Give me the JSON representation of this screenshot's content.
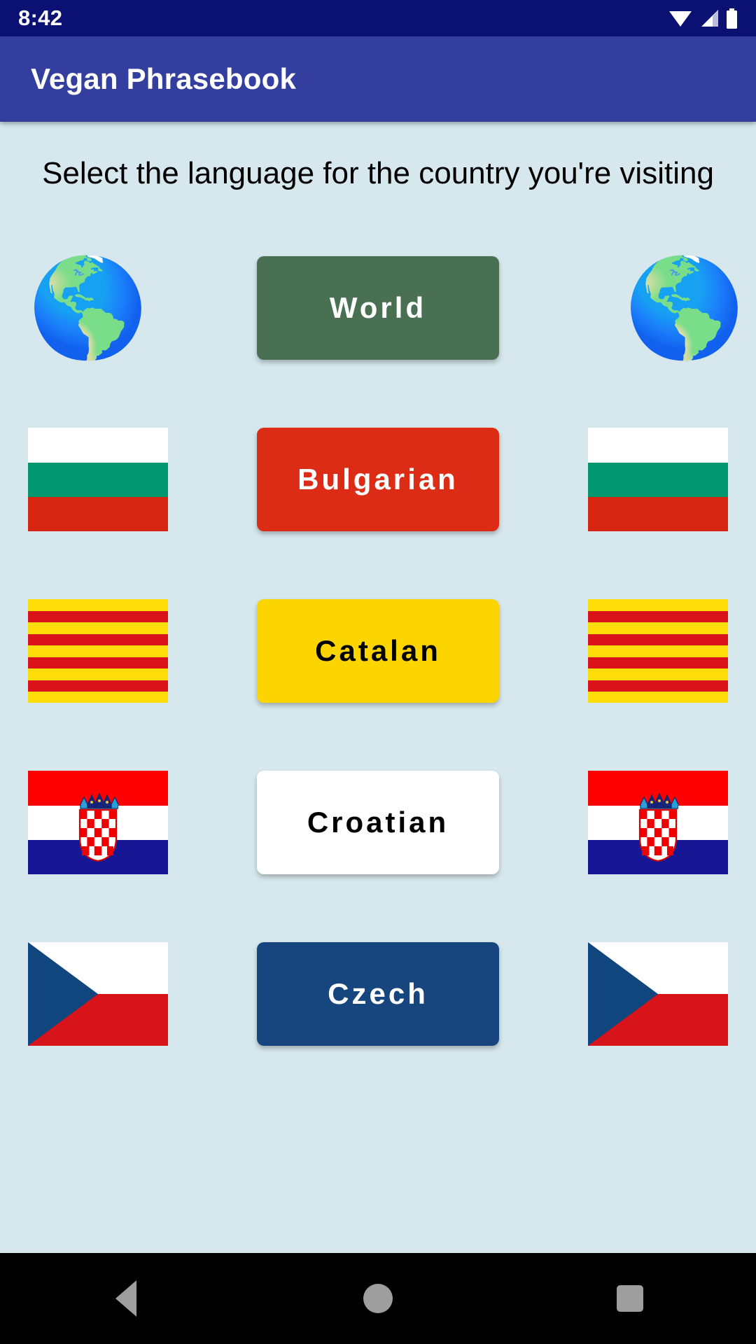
{
  "status_bar": {
    "time": "8:42",
    "icons": [
      "wifi-icon",
      "signal-icon",
      "battery-icon"
    ],
    "background": "#0a1172"
  },
  "app_bar": {
    "title": "Vegan Phrasebook",
    "background": "#333e9e",
    "text_color": "#ffffff"
  },
  "page": {
    "background": "#d6e8ed",
    "prompt": "Select the language for the country you're visiting"
  },
  "languages": [
    {
      "label": "World",
      "icon": "globe-icon",
      "icon_glyph": "🌎",
      "button_bg": "#4a7054",
      "button_text_color": "#ffffff",
      "flag_type": "globe"
    },
    {
      "label": "Bulgarian",
      "icon": "bulgaria-flag-icon",
      "button_bg": "#dd2c15",
      "button_text_color": "#ffffff",
      "flag_type": "bulgaria",
      "flag_colors": [
        "#ffffff",
        "#00966e",
        "#d62612"
      ]
    },
    {
      "label": "Catalan",
      "icon": "catalonia-flag-icon",
      "button_bg": "#fcd400",
      "button_text_color": "#000000",
      "flag_type": "catalonia",
      "flag_colors": [
        "#fcdd09",
        "#da121a"
      ]
    },
    {
      "label": "Croatian",
      "icon": "croatia-flag-icon",
      "button_bg": "#ffffff",
      "button_text_color": "#000000",
      "flag_type": "croatia",
      "flag_colors": [
        "#ff0000",
        "#ffffff",
        "#171796"
      ]
    },
    {
      "label": "Czech",
      "icon": "czechia-flag-icon",
      "button_bg": "#17467e",
      "button_text_color": "#ffffff",
      "flag_type": "czechia",
      "flag_colors": [
        "#ffffff",
        "#d7141a",
        "#11457e"
      ]
    }
  ],
  "nav_bar": {
    "background": "#000000",
    "icon_color": "#9e9e9e",
    "buttons": [
      {
        "name": "back-button",
        "icon": "back-triangle-icon"
      },
      {
        "name": "home-button",
        "icon": "home-circle-icon"
      },
      {
        "name": "recents-button",
        "icon": "recents-square-icon"
      }
    ]
  }
}
